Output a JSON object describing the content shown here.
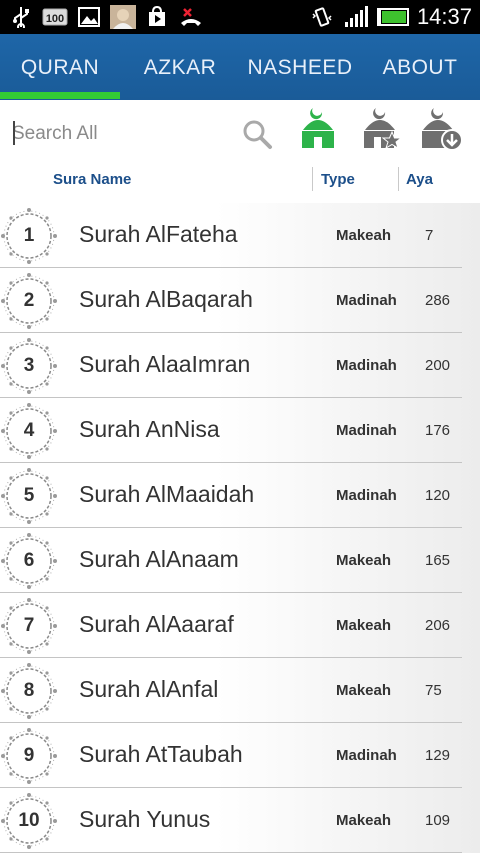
{
  "status_bar": {
    "time": "14:37",
    "battery_level": "100",
    "icons": [
      "usb-icon",
      "battery-badge-icon",
      "gallery-icon",
      "contact-photo",
      "play-store-icon",
      "missed-call-icon",
      "vibrate-icon",
      "signal-icon",
      "battery-icon"
    ]
  },
  "tabs": [
    {
      "label": "QURAN",
      "selected": true
    },
    {
      "label": "AZKAR",
      "selected": false
    },
    {
      "label": "NASHEED",
      "selected": false
    },
    {
      "label": "ABOUT",
      "selected": false
    }
  ],
  "search": {
    "placeholder": "Search All"
  },
  "toolbar": {
    "icons": [
      "mosque-home-icon",
      "mosque-favorites-icon",
      "mosque-download-icon"
    ],
    "accent": "#2db34a"
  },
  "columns": {
    "name": "Sura Name",
    "type": "Type",
    "aya": "Aya"
  },
  "suras": [
    {
      "num": "1",
      "name": "Surah AlFateha",
      "type": "Makeah",
      "aya": "7"
    },
    {
      "num": "2",
      "name": "Surah AlBaqarah",
      "type": "Madinah",
      "aya": "286"
    },
    {
      "num": "3",
      "name": "Surah AlaaImran",
      "type": "Madinah",
      "aya": "200"
    },
    {
      "num": "4",
      "name": "Surah AnNisa",
      "type": "Madinah",
      "aya": "176"
    },
    {
      "num": "5",
      "name": "Surah AlMaaidah",
      "type": "Madinah",
      "aya": "120"
    },
    {
      "num": "6",
      "name": "Surah AlAnaam",
      "type": "Makeah",
      "aya": "165"
    },
    {
      "num": "7",
      "name": "Surah AlAaaraf",
      "type": "Makeah",
      "aya": "206"
    },
    {
      "num": "8",
      "name": "Surah AlAnfal",
      "type": "Makeah",
      "aya": "75"
    },
    {
      "num": "9",
      "name": "Surah AtTaubah",
      "type": "Madinah",
      "aya": "129"
    },
    {
      "num": "10",
      "name": "Surah Yunus",
      "type": "Makeah",
      "aya": "109"
    }
  ],
  "colors": {
    "tab_bar": "#1e66a8",
    "tab_indicator": "#33cc33",
    "header_text": "#1c4f8a"
  }
}
